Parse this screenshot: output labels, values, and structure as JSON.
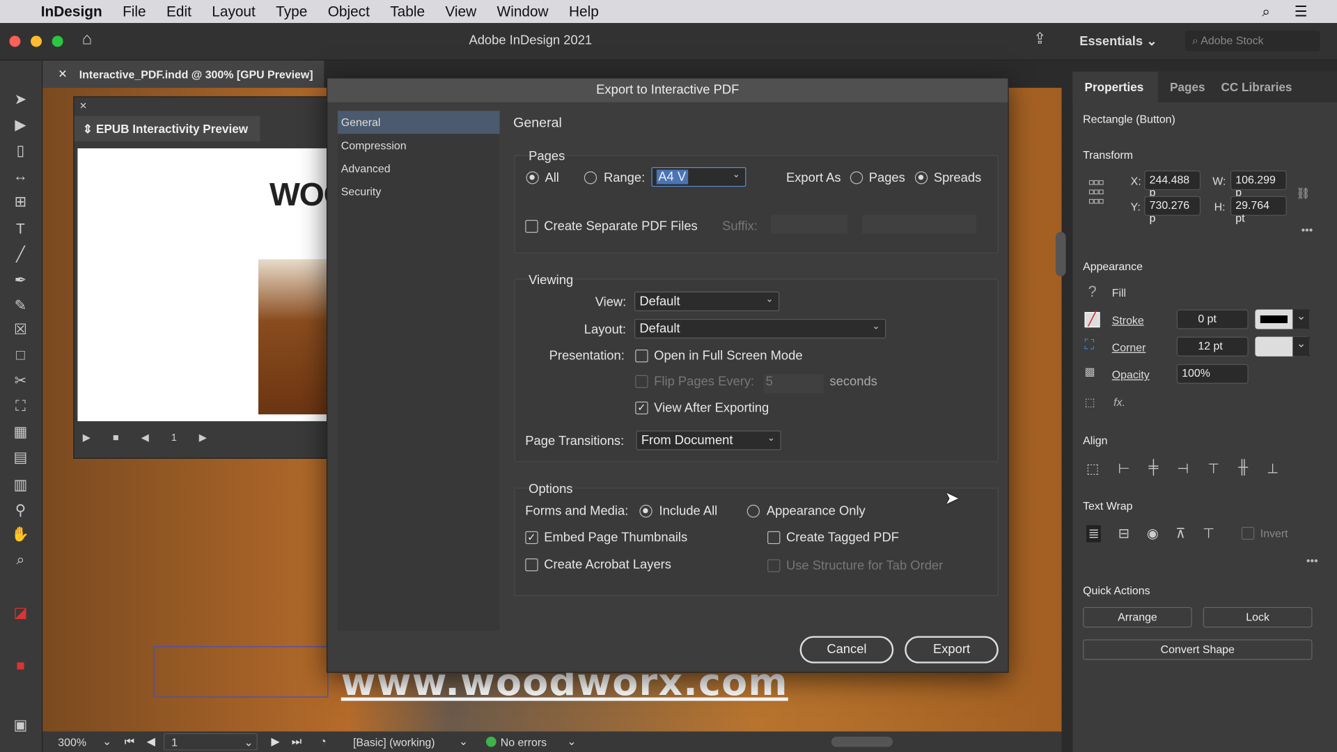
{
  "menubar": {
    "app": "InDesign",
    "items": [
      "File",
      "Edit",
      "Layout",
      "Type",
      "Object",
      "Table",
      "View",
      "Window",
      "Help"
    ]
  },
  "titlebar": {
    "title": "Adobe InDesign 2021",
    "workspace": "Essentials",
    "search_placeholder": "Adobe Stock"
  },
  "document": {
    "tab": "Interactive_PDF.indd @ 300% [GPU Preview]",
    "epub_panel_title": "EPUB Interactivity Preview",
    "epub_page": "1",
    "preview_heading": "WOO",
    "banner_text": "www.woodworx.com"
  },
  "status": {
    "zoom": "300%",
    "page": "1",
    "preflight_profile": "[Basic] (working)",
    "errors": "No errors"
  },
  "dialog": {
    "title": "Export to Interactive PDF",
    "nav": [
      "General",
      "Compression",
      "Advanced",
      "Security"
    ],
    "section_title": "General",
    "pages": {
      "heading": "Pages",
      "all": "All",
      "range": "Range:",
      "range_value": "A4 V",
      "export_as": "Export As",
      "pages_opt": "Pages",
      "spreads_opt": "Spreads",
      "separate": "Create Separate PDF Files",
      "suffix": "Suffix:"
    },
    "viewing": {
      "heading": "Viewing",
      "view_label": "View:",
      "view_value": "Default",
      "layout_label": "Layout:",
      "layout_value": "Default",
      "presentation_label": "Presentation:",
      "fullscreen": "Open in Full Screen Mode",
      "flip": "Flip Pages Every:",
      "flip_value": "5",
      "seconds": "seconds",
      "view_after": "View After Exporting",
      "transitions_label": "Page Transitions:",
      "transitions_value": "From Document"
    },
    "options": {
      "heading": "Options",
      "forms_label": "Forms and Media:",
      "include_all": "Include All",
      "appearance_only": "Appearance Only",
      "thumbnails": "Embed Page Thumbnails",
      "tagged": "Create Tagged PDF",
      "layers": "Create Acrobat Layers",
      "structure": "Use Structure for Tab Order"
    },
    "cancel": "Cancel",
    "export": "Export"
  },
  "panel": {
    "tabs": [
      "Properties",
      "Pages",
      "CC Libraries"
    ],
    "object": "Rectangle (Button)",
    "transform": {
      "heading": "Transform",
      "x_label": "X:",
      "x": "244.488 p",
      "y_label": "Y:",
      "y": "730.276 p",
      "w_label": "W:",
      "w": "106.299 p",
      "h_label": "H:",
      "h": "29.764 pt"
    },
    "appearance": {
      "heading": "Appearance",
      "fill": "Fill",
      "stroke": "Stroke",
      "stroke_value": "0 pt",
      "corner": "Corner",
      "corner_value": "12 pt",
      "opacity": "Opacity",
      "opacity_value": "100%",
      "fx": "fx."
    },
    "align_heading": "Align",
    "textwrap_heading": "Text Wrap",
    "invert": "Invert",
    "quick_actions": "Quick Actions",
    "arrange": "Arrange",
    "lock": "Lock",
    "convert_shape": "Convert Shape"
  }
}
